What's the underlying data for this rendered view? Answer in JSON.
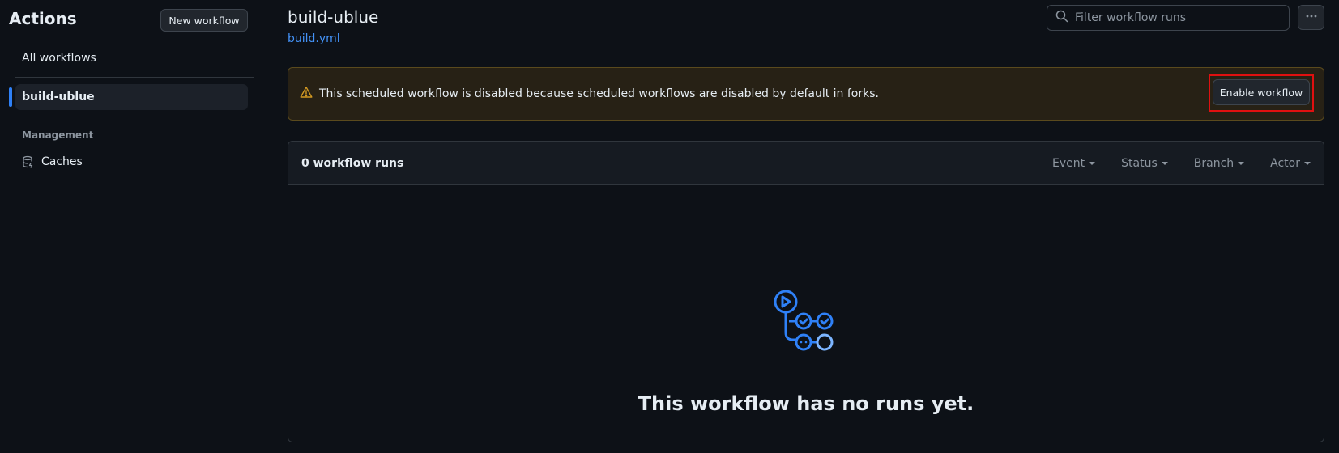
{
  "sidebar": {
    "title": "Actions",
    "new_workflow_label": "New workflow",
    "all_workflows_label": "All workflows",
    "active_workflow_label": "build-ublue",
    "management_heading": "Management",
    "caches_label": "Caches",
    "caches_icon": "database-icon"
  },
  "header": {
    "title": "build-ublue",
    "file_link": "build.yml",
    "search_placeholder": "Filter workflow runs",
    "more_icon": "kebab-horizontal-icon"
  },
  "banner": {
    "icon": "alert-icon",
    "message": "This scheduled workflow is disabled because scheduled workflows are disabled by default in forks.",
    "enable_label": "Enable workflow"
  },
  "runs": {
    "count_label": "0 workflow runs",
    "filters": [
      "Event",
      "Status",
      "Branch",
      "Actor"
    ],
    "empty_icon": "workflow-icon",
    "empty_message": "This workflow has no runs yet."
  },
  "colors": {
    "accent": "#2f81f7",
    "warning": "#d29922",
    "highlight_border": "#e01010"
  }
}
